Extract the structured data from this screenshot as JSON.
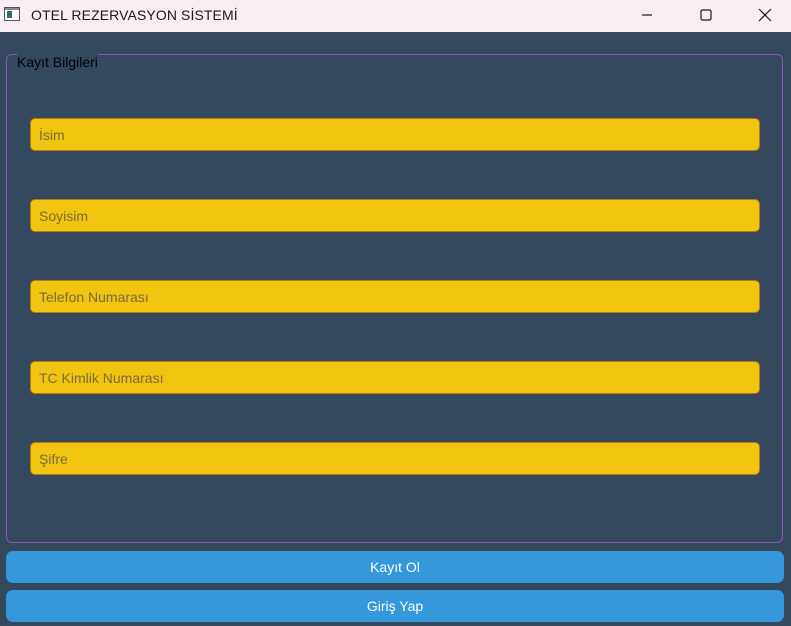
{
  "window": {
    "title": "OTEL REZERVASYON SİSTEMİ",
    "icons": {
      "app": "app-window-icon",
      "minimize": "minimize-icon",
      "maximize": "maximize-icon",
      "close": "close-icon"
    }
  },
  "form": {
    "group_title": "Kayıt Bilgileri",
    "fields": {
      "first_name": {
        "placeholder": "İsim",
        "value": ""
      },
      "last_name": {
        "placeholder": "Soyisim",
        "value": ""
      },
      "phone": {
        "placeholder": "Telefon Numarası",
        "value": ""
      },
      "tc_id": {
        "placeholder": "TC Kimlik Numarası",
        "value": ""
      },
      "password": {
        "placeholder": "Şifre",
        "value": ""
      }
    }
  },
  "actions": {
    "register_label": "Kayıt Ol",
    "login_label": "Giriş Yap"
  },
  "colors": {
    "background": "#34495e",
    "field": "#f1c40f",
    "button": "#3498db",
    "group_border": "#8e58b9"
  }
}
